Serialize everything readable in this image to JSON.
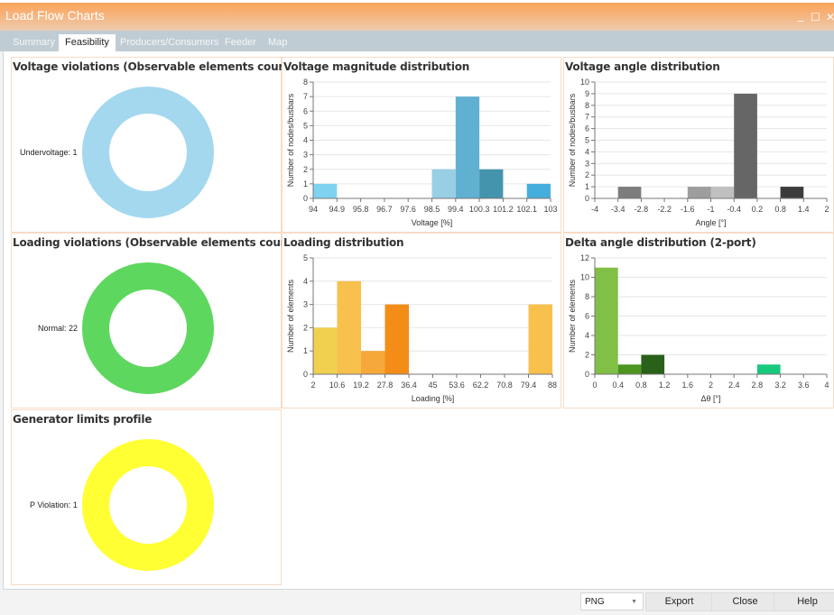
{
  "window": {
    "title": "Load Flow Charts",
    "minimize_glyph": "_",
    "maximize_glyph": "☐",
    "close_glyph": "✕"
  },
  "tabs": [
    {
      "label": "Summary",
      "active": false
    },
    {
      "label": "Feasibility",
      "active": true
    },
    {
      "label": "Producers/Consumers",
      "active": false
    },
    {
      "label": "Feeder",
      "active": false
    },
    {
      "label": "Map",
      "active": false
    }
  ],
  "panels": {
    "voltage_violations": {
      "title": "Voltage violations (Observable elements counted)"
    },
    "loading_violations": {
      "title": "Loading violations (Observable elements counted)"
    },
    "generator_limits": {
      "title": "Generator limits profile"
    },
    "voltage_magnitude": {
      "title": "Voltage magnitude distribution"
    },
    "voltage_angle": {
      "title": "Voltage angle distribution"
    },
    "loading_distribution": {
      "title": "Loading distribution"
    },
    "delta_angle": {
      "title": "Delta angle distribution (2-port)"
    }
  },
  "footer": {
    "format_value": "PNG",
    "export_label": "Export",
    "close_label": "Close",
    "help_label": "Help"
  },
  "chart_data": [
    {
      "id": "voltage_violations",
      "type": "pie",
      "variant": "donut",
      "title": "Voltage violations (Observable elements counted)",
      "slices": [
        {
          "label": "Undervoltage",
          "value": 1,
          "color": "#a3d8ef"
        }
      ],
      "slice_label_text": [
        "Undervoltage: 1"
      ]
    },
    {
      "id": "loading_violations",
      "type": "pie",
      "variant": "donut",
      "title": "Loading violations (Observable elements counted)",
      "slices": [
        {
          "label": "Normal",
          "value": 22,
          "color": "#5ed75f"
        }
      ],
      "slice_label_text": [
        "Normal: 22"
      ]
    },
    {
      "id": "generator_limits",
      "type": "pie",
      "variant": "donut",
      "title": "Generator limits profile",
      "slices": [
        {
          "label": "P Violation",
          "value": 1,
          "color": "#ffff33"
        }
      ],
      "slice_label_text": [
        "P Violation: 1"
      ]
    },
    {
      "id": "voltage_magnitude",
      "type": "bar",
      "variant": "histogram",
      "title": "Voltage magnitude distribution",
      "xlabel": "Voltage [%]",
      "ylabel": "Number of nodes/busbars",
      "xlim": [
        94,
        103
      ],
      "ylim": [
        0,
        8
      ],
      "xticks": [
        "94",
        "94.9",
        "95.8",
        "96.7",
        "97.6",
        "98.5",
        "99.4",
        "100.3",
        "101.2",
        "102.1",
        "103"
      ],
      "yticks": [
        0,
        1,
        2,
        3,
        4,
        5,
        6,
        7,
        8
      ],
      "grid": true,
      "bins": [
        {
          "from": 94,
          "to": 94.9,
          "value": 1,
          "color": "#7fd3f0"
        },
        {
          "from": 98.5,
          "to": 99.4,
          "value": 2,
          "color": "#98cfe5"
        },
        {
          "from": 99.4,
          "to": 100.3,
          "value": 7,
          "color": "#60b1d1"
        },
        {
          "from": 100.3,
          "to": 101.2,
          "value": 2,
          "color": "#4594ad"
        },
        {
          "from": 102.1,
          "to": 103,
          "value": 1,
          "color": "#46aedc"
        }
      ]
    },
    {
      "id": "voltage_angle",
      "type": "bar",
      "variant": "histogram",
      "title": "Voltage angle distribution",
      "xlabel": "Angle [°]",
      "ylabel": "Number of nodes/busbars",
      "xlim": [
        -4,
        2
      ],
      "ylim": [
        0,
        10
      ],
      "xticks": [
        "-4",
        "-3.4",
        "-2.8",
        "-2.2",
        "-1.6",
        "-1",
        "-0.4",
        "0.2",
        "0.8",
        "1.4",
        "2"
      ],
      "yticks": [
        0,
        1,
        2,
        3,
        4,
        5,
        6,
        7,
        8,
        9,
        10
      ],
      "grid": true,
      "bins": [
        {
          "from": -3.4,
          "to": -2.8,
          "value": 1,
          "color": "#7d7d7d"
        },
        {
          "from": -1.6,
          "to": -1.0,
          "value": 1,
          "color": "#9d9d9d"
        },
        {
          "from": -1.0,
          "to": -0.4,
          "value": 1,
          "color": "#c0c0c0"
        },
        {
          "from": -0.4,
          "to": 0.2,
          "value": 9,
          "color": "#666666"
        },
        {
          "from": 0.8,
          "to": 1.4,
          "value": 1,
          "color": "#3c3c3c"
        }
      ]
    },
    {
      "id": "loading_distribution",
      "type": "bar",
      "variant": "histogram",
      "title": "Loading distribution",
      "xlabel": "Loading  [%]",
      "ylabel": "Number of elements",
      "xlim": [
        2,
        88
      ],
      "ylim": [
        0,
        5
      ],
      "xticks": [
        "2",
        "10.6",
        "19.2",
        "27.8",
        "36.4",
        "45",
        "53.6",
        "62.2",
        "70.8",
        "79.4",
        "88"
      ],
      "yticks": [
        0,
        1,
        2,
        3,
        4,
        5
      ],
      "grid": true,
      "bins": [
        {
          "from": 2,
          "to": 10.6,
          "value": 2,
          "color": "#f0d04e"
        },
        {
          "from": 10.6,
          "to": 19.2,
          "value": 4,
          "color": "#f8c14d"
        },
        {
          "from": 19.2,
          "to": 27.8,
          "value": 1,
          "color": "#f7a83a"
        },
        {
          "from": 27.8,
          "to": 36.4,
          "value": 3,
          "color": "#f38d18"
        },
        {
          "from": 79.4,
          "to": 88,
          "value": 3,
          "color": "#f8c14d"
        }
      ]
    },
    {
      "id": "delta_angle",
      "type": "bar",
      "variant": "histogram",
      "title": "Delta angle distribution (2-port)",
      "xlabel": "Δθ  [°]",
      "ylabel": "Number of elements",
      "xlim": [
        0,
        4
      ],
      "ylim": [
        0,
        12
      ],
      "xticks": [
        "0",
        "0.4",
        "0.8",
        "1.2",
        "1.6",
        "2",
        "2.4",
        "2.8",
        "3.2",
        "3.6",
        "4"
      ],
      "yticks": [
        0,
        2,
        4,
        6,
        8,
        10,
        12
      ],
      "grid": true,
      "bins": [
        {
          "from": 0,
          "to": 0.4,
          "value": 11,
          "color": "#82bf46"
        },
        {
          "from": 0.4,
          "to": 0.8,
          "value": 1,
          "color": "#4c951f"
        },
        {
          "from": 0.8,
          "to": 1.2,
          "value": 2,
          "color": "#29611a"
        },
        {
          "from": 2.8,
          "to": 3.2,
          "value": 1,
          "color": "#17c97c"
        }
      ]
    }
  ]
}
